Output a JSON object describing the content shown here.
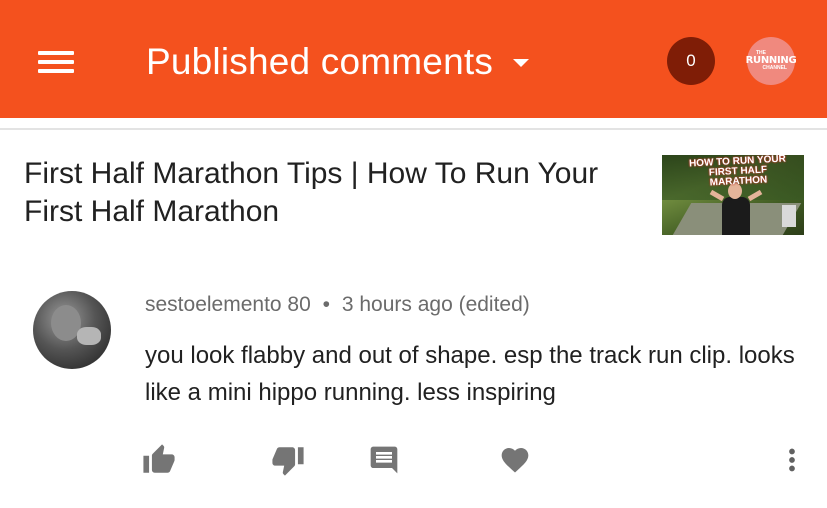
{
  "app_bar": {
    "title": "Published comments",
    "notification_count": "0",
    "channel_logo_text": {
      "small_top": "THE",
      "main": "RUNNING",
      "small_bottom": "CHANNEL"
    }
  },
  "video": {
    "title": "First Half Marathon Tips | How To Run Your First Half Marathon",
    "thumbnail_text": "HOW TO RUN YOUR FIRST HALF MARATHON"
  },
  "comment": {
    "author": "sestoelemento 80",
    "separator": "•",
    "time": "3 hours ago (edited)",
    "text": "you look flabby and out of shape. esp the track run clip. looks like a mini hippo running. less inspiring"
  },
  "actions": {
    "icons": [
      "thumb-up-icon",
      "thumb-down-icon",
      "reply-comment-icon",
      "heart-icon",
      "more-vert-icon"
    ]
  },
  "colors": {
    "app_bar": "#f4511e",
    "badge": "#7f1d06",
    "icon_gray": "#757575",
    "text_primary": "#212121",
    "text_secondary": "#6b6b6b"
  }
}
